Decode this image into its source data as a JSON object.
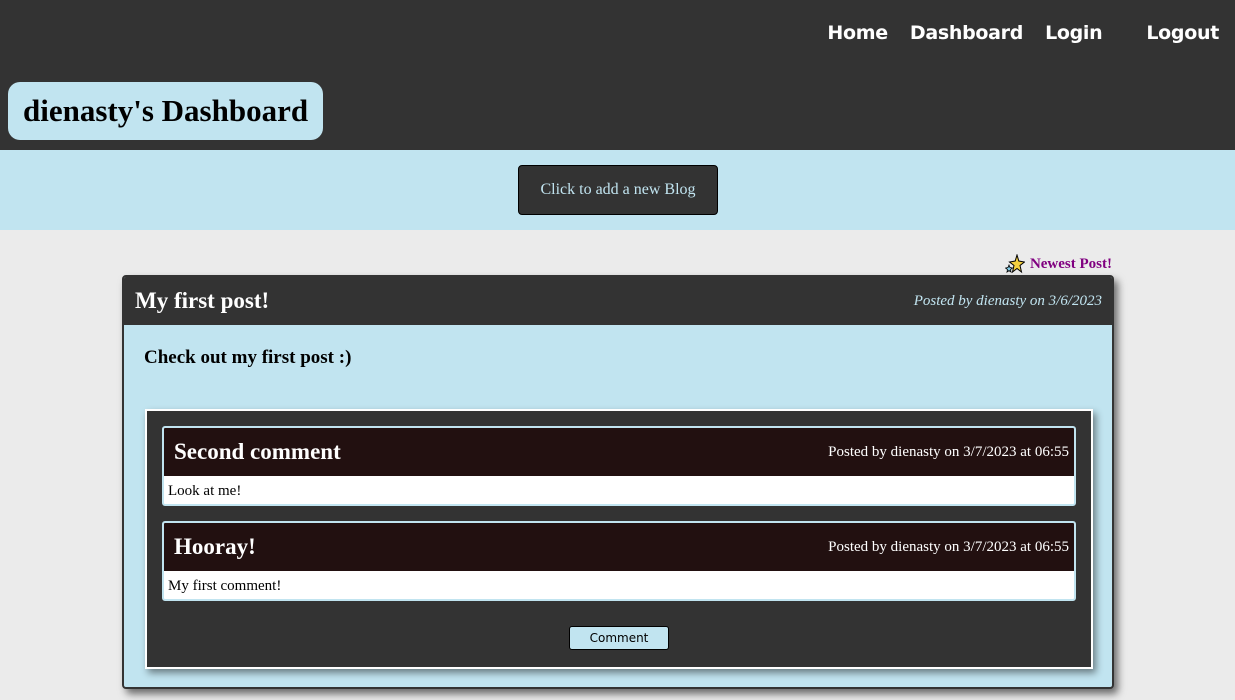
{
  "nav": {
    "items": [
      {
        "label": "Home"
      },
      {
        "label": "Dashboard"
      },
      {
        "label": "Login"
      },
      {
        "label": "Logout"
      }
    ]
  },
  "page": {
    "title": "dienasty's Dashboard",
    "add_blog_label": "Click to add a new Blog",
    "newest_label": "Newest Post!"
  },
  "post": {
    "title": "My first post!",
    "meta": "Posted by dienasty on 3/6/2023",
    "body": "Check out my first post :)",
    "comment_button_label": "Comment",
    "comments": [
      {
        "title": "Second comment",
        "meta": "Posted by dienasty on 3/7/2023 at 06:55",
        "text": "Look at me!"
      },
      {
        "title": "Hooray!",
        "meta": "Posted by dienasty on 3/7/2023 at 06:55",
        "text": "My first comment!"
      }
    ]
  },
  "colors": {
    "header_bg": "#333333",
    "accent_light_blue": "#c1e4f0",
    "page_bg": "#ebebeb",
    "comment_header_bg": "#221010",
    "newest_text": "#800080"
  },
  "icons": {
    "newest": "sparkle-star-icon"
  }
}
